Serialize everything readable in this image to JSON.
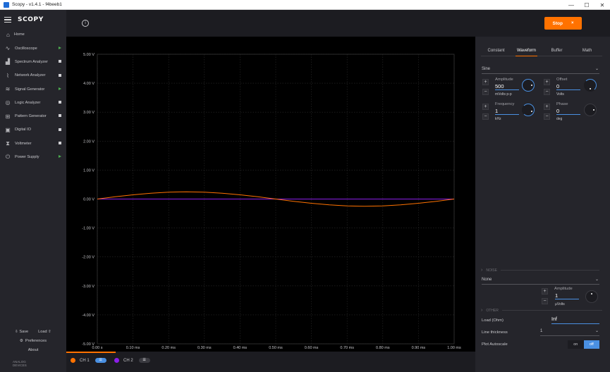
{
  "window": {
    "title": "Scopy - v1.4.1 - f4beeb1",
    "minimize": "—",
    "maximize": "☐",
    "close": "✕"
  },
  "sidebar": {
    "logo": "SCOPY",
    "home_label": "Home",
    "items": [
      {
        "label": "Oscilloscope",
        "icon": "oscilloscope-icon",
        "glyph": "∿",
        "state": "running"
      },
      {
        "label": "Spectrum Analyzer",
        "icon": "spectrum-icon",
        "glyph": "▟",
        "state": "stopped"
      },
      {
        "label": "Network Analyzer",
        "icon": "network-icon",
        "glyph": "⌇",
        "state": "stopped"
      },
      {
        "label": "Signal Generator",
        "icon": "signal-generator-icon",
        "glyph": "≋",
        "state": "running"
      },
      {
        "label": "Logic Analyzer",
        "icon": "logic-analyzer-icon",
        "glyph": "◎",
        "state": "stopped"
      },
      {
        "label": "Pattern Generator",
        "icon": "pattern-generator-icon",
        "glyph": "⊞",
        "state": "stopped"
      },
      {
        "label": "Digital IO",
        "icon": "digital-io-icon",
        "glyph": "▣",
        "state": "stopped"
      },
      {
        "label": "Voltmeter",
        "icon": "voltmeter-icon",
        "glyph": "⧗",
        "state": "stopped"
      },
      {
        "label": "Power Supply",
        "icon": "power-supply-icon",
        "glyph": "⏻",
        "state": "running"
      }
    ],
    "save_label": "Save",
    "load_label": "Load",
    "preferences_label": "Preferences",
    "about_label": "About",
    "vendor_line1": "ANALOG",
    "vendor_line2": "DEVICES"
  },
  "toolbar": {
    "info_glyph": "i",
    "run_button_label": "Stop",
    "run_button_icon": "×",
    "accent_color": "#ff7200"
  },
  "chart_data": {
    "type": "line",
    "xlabel": "",
    "ylabel": "",
    "xlim": [
      0,
      1.0
    ],
    "ylim": [
      -5.0,
      5.0
    ],
    "grid": true,
    "x_ticks": [
      "0.00 s",
      "0.10 ms",
      "0.20 ms",
      "0.30 ms",
      "0.40 ms",
      "0.50 ms",
      "0.60 ms",
      "0.70 ms",
      "0.80 ms",
      "0.90 ms",
      "1.00 ms"
    ],
    "y_ticks": [
      "5.00 V",
      "4.00 V",
      "3.00 V",
      "2.00 V",
      "1.00 V",
      "0.00 V",
      "-1.00 V",
      "-2.00 V",
      "-3.00 V",
      "-4.00 V",
      "-5.00 V"
    ],
    "series": [
      {
        "channel": "CH 1",
        "color": "#ff7200",
        "x": [
          0,
          0.05,
          0.1,
          0.15,
          0.2,
          0.25,
          0.3,
          0.35,
          0.4,
          0.45,
          0.5,
          0.55,
          0.6,
          0.65,
          0.7,
          0.75,
          0.8,
          0.85,
          0.9,
          0.95,
          1.0
        ],
        "y": [
          0,
          0.077,
          0.147,
          0.202,
          0.238,
          0.25,
          0.238,
          0.202,
          0.147,
          0.077,
          0,
          -0.077,
          -0.147,
          -0.202,
          -0.238,
          -0.25,
          -0.238,
          -0.202,
          -0.147,
          -0.077,
          0
        ]
      },
      {
        "channel": "CH 2",
        "color": "#8b1ee8",
        "x": [
          0,
          1.0
        ],
        "y": [
          0,
          0
        ]
      }
    ]
  },
  "channels": [
    {
      "label": "CH 1",
      "color": "#ff7200",
      "pill_color": "#4a90e2",
      "pill_glyph": "☰"
    },
    {
      "label": "CH 2",
      "color": "#8b1ee8",
      "pill_color": "#3a3a40",
      "pill_glyph": "☰"
    }
  ],
  "panel": {
    "tabs": [
      "Constant",
      "Waveform",
      "Buffer",
      "Math"
    ],
    "active_tab": "Waveform",
    "waveform_type": "Sine",
    "amplitude": {
      "label": "Amplitude",
      "value": "500",
      "unit": "mVolts p-p"
    },
    "offset": {
      "label": "Offset",
      "value": "0",
      "unit": "Volts"
    },
    "frequency": {
      "label": "Frequency",
      "value": "1",
      "unit": "kHz"
    },
    "phase": {
      "label": "Phase",
      "value": "0",
      "unit": "deg"
    },
    "noise_section": "NOISE",
    "noise_type": "None",
    "noise_amplitude": {
      "label": "Amplitude",
      "value": "1",
      "unit": "µVolts"
    },
    "other_section": "OTHER",
    "load_label": "Load (Ohm)",
    "load_value": "Inf",
    "line_thickness_label": "Line thickness",
    "line_thickness_value": "1",
    "plot_autoscale_label": "Plot Autoscale",
    "toggle_on": "on",
    "toggle_off": "off",
    "plus": "+",
    "minus": "−",
    "chevron": "⌄",
    "section_chevron": "›"
  }
}
